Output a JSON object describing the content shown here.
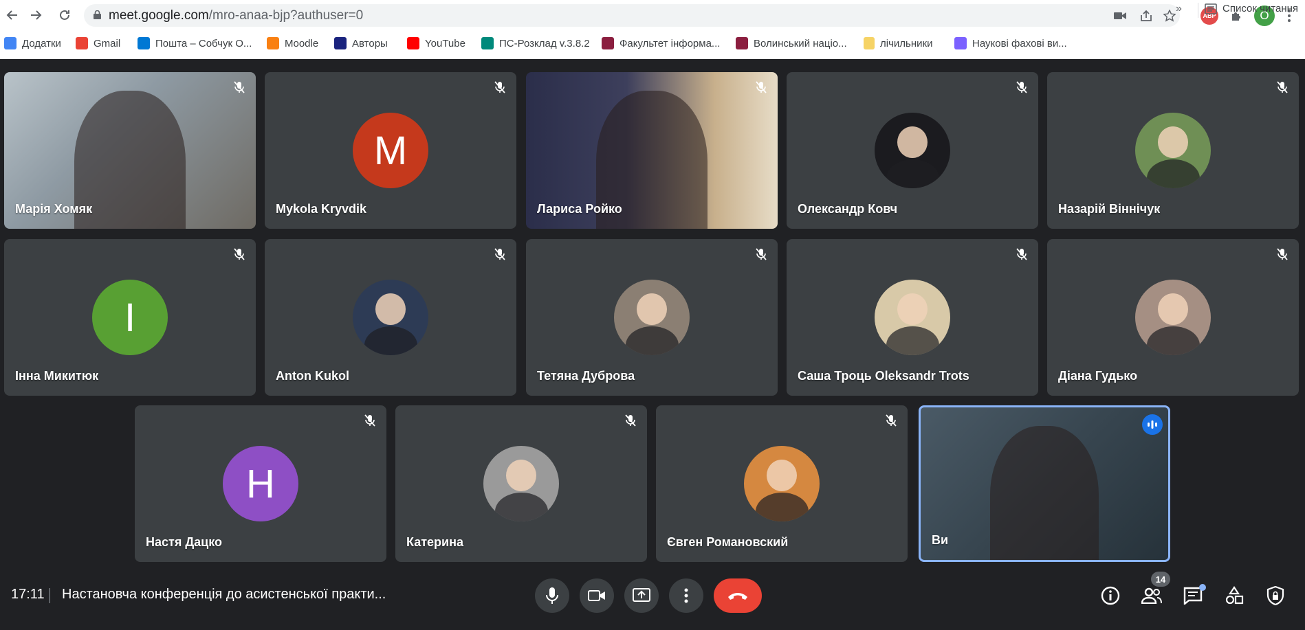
{
  "browser": {
    "url_host": "meet.google.com",
    "url_path": "/mro-anaa-bjp?authuser=0",
    "profile_initial": "O",
    "abp_label": "ABP",
    "bookmarks": [
      {
        "label": "Додатки",
        "icon": "apps-grid-icon",
        "color": "#4285f4"
      },
      {
        "label": "Gmail",
        "icon": "gmail-icon",
        "color": "#ea4335"
      },
      {
        "label": "Пошта – Собчук О...",
        "icon": "outlook-icon",
        "color": "#0078d4"
      },
      {
        "label": "Moodle",
        "icon": "moodle-icon",
        "color": "#f98012"
      },
      {
        "label": "Авторы",
        "icon": "authors-icon",
        "color": "#1a237e"
      },
      {
        "label": "YouTube",
        "icon": "youtube-icon",
        "color": "#ff0000"
      },
      {
        "label": "ПС-Розклад v.3.8.2",
        "icon": "schedule-icon",
        "color": "#00897b"
      },
      {
        "label": "Факультет інформа...",
        "icon": "university-shield-icon",
        "color": "#8b1e3f"
      },
      {
        "label": "Волинський націо...",
        "icon": "university-shield-icon",
        "color": "#8b1e3f"
      },
      {
        "label": "лічильники",
        "icon": "folder-icon",
        "color": "#f6d365"
      },
      {
        "label": "Наукові фахові ви...",
        "icon": "apps-dots-icon",
        "color": "#7b61ff"
      }
    ],
    "more_label": "»",
    "reading_list": "Список читання"
  },
  "participants": [
    {
      "name": "Марія Хомяк",
      "type": "video",
      "muted": true
    },
    {
      "name": "Mykola Kryvdik",
      "type": "letter",
      "letter": "M",
      "color": "#c5391c",
      "muted": true
    },
    {
      "name": "Лариса Ройко",
      "type": "video",
      "muted": true
    },
    {
      "name": "Олександр Ковч",
      "type": "photo",
      "color": "#1b1b1f",
      "muted": true
    },
    {
      "name": "Назарій Віннічук",
      "type": "photo",
      "color": "#6f8f55",
      "muted": true
    },
    {
      "name": "Інна Микитюк",
      "type": "letter",
      "letter": "I",
      "color": "#58a033",
      "muted": true
    },
    {
      "name": "Anton Kukol",
      "type": "photo",
      "color": "#2d3b55",
      "muted": true
    },
    {
      "name": "Тетяна Дуброва",
      "type": "photo",
      "color": "#8b7f73",
      "muted": true
    },
    {
      "name": "Саша Троць Oleksandr Trots",
      "type": "photo",
      "color": "#d8c9a8",
      "muted": true
    },
    {
      "name": "Діана Гудько",
      "type": "photo",
      "color": "#a58f83",
      "muted": true
    },
    {
      "name": "Настя Дацко",
      "type": "letter",
      "letter": "H",
      "color": "#8e4fc5",
      "muted": true
    },
    {
      "name": "Катерина",
      "type": "photo",
      "color": "#9a9a9a",
      "muted": true
    },
    {
      "name": "Євген Романовский",
      "type": "photo",
      "color": "#d58840",
      "muted": true
    },
    {
      "name": "Ви",
      "type": "video",
      "muted": false,
      "speaking": true
    }
  ],
  "meeting": {
    "time": "17:11",
    "title": "Настановча конференція до асистенської практи...",
    "participants_count": "14"
  },
  "colors": {
    "background": "#202124",
    "tile": "#3c4043",
    "end_call": "#ea4335",
    "active_speaker": "#8ab4f8"
  }
}
